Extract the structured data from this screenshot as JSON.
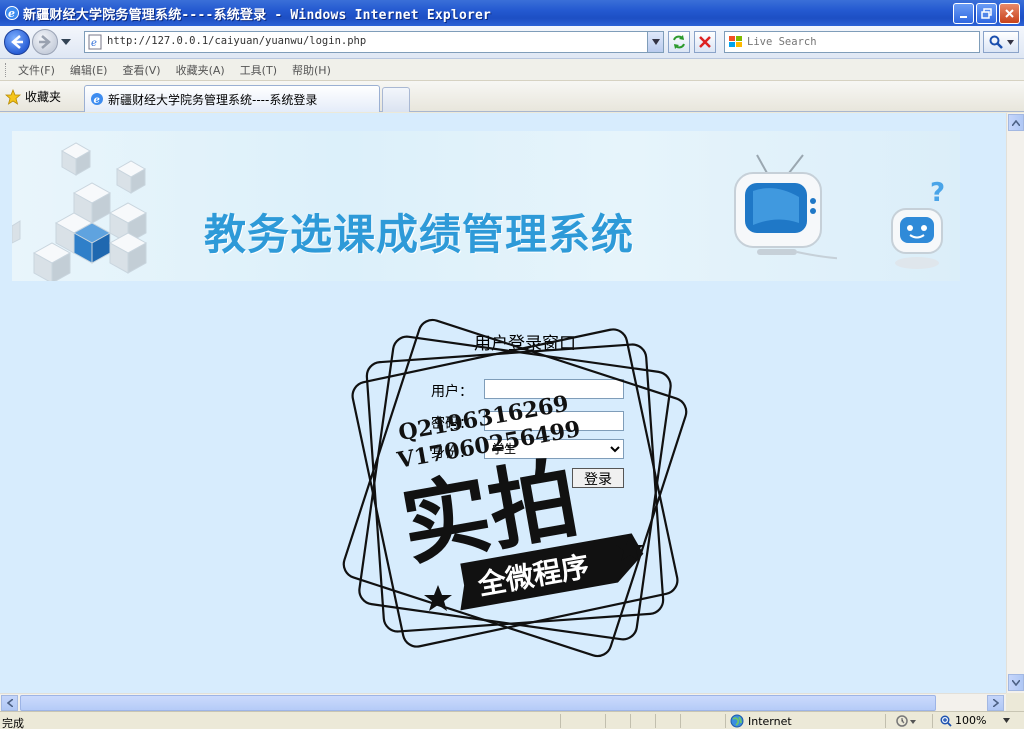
{
  "window": {
    "title": "新疆财经大学院务管理系统----系统登录 - Windows Internet Explorer"
  },
  "address_bar": {
    "url": "http://127.0.0.1/caiyuan/yuanwu/login.php"
  },
  "search": {
    "placeholder": "Live Search"
  },
  "menu": [
    "文件(F)",
    "编辑(E)",
    "查看(V)",
    "收藏夹(A)",
    "工具(T)",
    "帮助(H)"
  ],
  "favorites": {
    "label": "收藏夹"
  },
  "tab": {
    "title": "新疆财经大学院务管理系统----系统登录"
  },
  "banner": {
    "heading": "教务选课成绩管理系统"
  },
  "login_form": {
    "title": "用户登录窗口",
    "username_label": "用户：",
    "password_label": "密码：",
    "role_label": "身份：",
    "role_selected": "学生",
    "submit_label": "登录"
  },
  "watermark": {
    "line1": "Q2196316269",
    "line2": "V17060256499",
    "main": "实拍",
    "sub": "全微程序"
  },
  "status_bar": {
    "status": "完成",
    "zone": "Internet",
    "zoom": "100%"
  },
  "colors": {
    "page_background": "#d7ecfd",
    "banner_heading": "#2e9ad8",
    "title_bar": "#2459d0"
  }
}
